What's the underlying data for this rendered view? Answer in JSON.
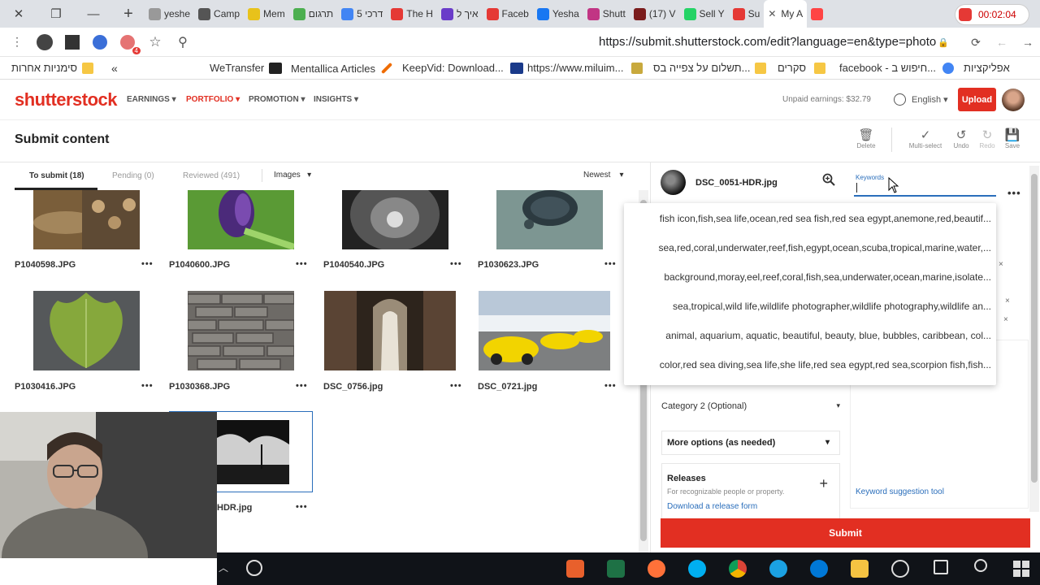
{
  "browser": {
    "tabs": [
      "yeshe",
      "Camp",
      "Mem",
      "תרגום",
      "5 דרכי",
      "The H",
      "איך ל",
      "Faceb",
      "Yesha",
      "Shutt",
      "(17) V",
      "Sell Y",
      "Su",
      "My A"
    ],
    "recording_time": "00:02:04",
    "url": "https://submit.shutterstock.com/edit?language=en&type=photo",
    "bookmarks": [
      "סימניות אחרות",
      "WeTransfer",
      "Mentallica Articles",
      "KeepVid: Download...",
      "https://www.miluim...",
      "תשלום על צפייה בס...",
      "סקרים",
      "facebook - חיפוש ב...",
      "אפליקציות"
    ],
    "new_tab": "+",
    "extension_badge": "4"
  },
  "site": {
    "logo": "shutterstock",
    "nav": [
      "EARNINGS",
      "PORTFOLIO",
      "PROMOTION",
      "INSIGHTS"
    ],
    "unpaid": "Unpaid earnings: $32.79",
    "language": "English",
    "upload": "Upload"
  },
  "toolbar": {
    "title": "Submit content",
    "buttons": [
      "Delete",
      "Multi-select",
      "Undo",
      "Redo",
      "Save"
    ]
  },
  "subtabs": {
    "to_submit": "To submit (18)",
    "pending": "Pending (0)",
    "reviewed": "Reviewed (491)",
    "images": "Images",
    "sort": "Newest"
  },
  "files": [
    {
      "name": "P1040598.JPG"
    },
    {
      "name": "P1040600.JPG"
    },
    {
      "name": "P1040540.JPG"
    },
    {
      "name": "P1030623.JPG"
    },
    {
      "name": "P1030416.JPG"
    },
    {
      "name": "P1030368.JPG"
    },
    {
      "name": "DSC_0756.jpg"
    },
    {
      "name": "DSC_0721.jpg"
    },
    {
      "name": "HDR.jpg"
    }
  ],
  "panel": {
    "filename": "DSC_0051-HDR.jpg",
    "keywords_label": "Keywords",
    "category2": "Category 2 (Optional)",
    "more_options": "More options (as needed)",
    "releases_title": "Releases",
    "releases_sub": "For recognizable people or property.",
    "releases_link": "Download a release form",
    "keyword_tool": "Keyword suggestion tool",
    "submit": "Submit",
    "remove_mark": "×"
  },
  "autocomplete": [
    "fish icon,fish,sea life,ocean,red sea fish,red sea egypt,anemone,red,beautif...",
    "sea,red,coral,underwater,reef,fish,egypt,ocean,scuba,tropical,marine,water,...",
    "background,moray,eel,reef,coral,fish,sea,underwater,ocean,marine,isolate...",
    "sea,tropical,wild life,wildlife photographer,wildlife photography,wildlife an...",
    "animal, aquarium, aquatic, beautiful, beauty, blue, bubbles, caribbean, col...",
    "color,red sea diving,sea life,she life,red sea egypt,red sea,scorpion fish,fish..."
  ],
  "icons": {
    "more": "•••",
    "chevron_down": "▾",
    "plus": "+",
    "close": "✕",
    "delete": "🗑",
    "multiselect": "✓",
    "undo": "↺",
    "redo": "↻",
    "save": "💾",
    "minimize": "—",
    "restore": "❐",
    "menu_kebab": "⋮",
    "star": "☆",
    "search": "⚲",
    "lock": "🔒",
    "reload": "⟳",
    "back": "←",
    "forward": "→",
    "collapse": "«"
  }
}
